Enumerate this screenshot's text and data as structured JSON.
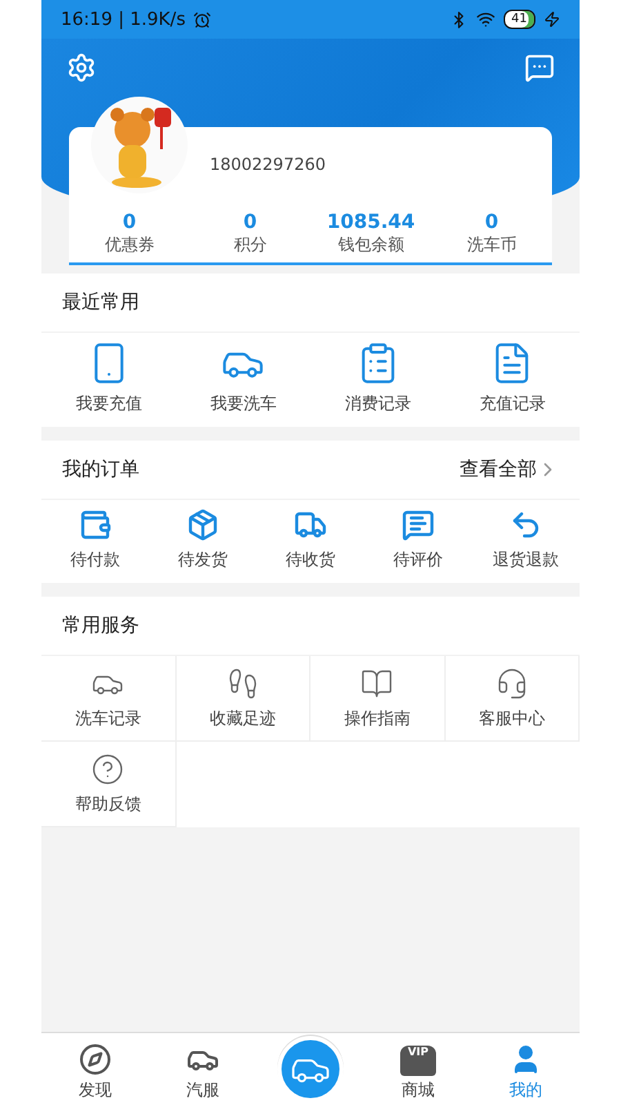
{
  "status_bar": {
    "time": "16:19 | 1.9K/s",
    "battery": "41"
  },
  "profile": {
    "phone": "18002297260",
    "stats": [
      {
        "value": "0",
        "label": "优惠券"
      },
      {
        "value": "0",
        "label": "积分"
      },
      {
        "value": "1085.44",
        "label": "钱包余额"
      },
      {
        "value": "0",
        "label": "洗车币"
      }
    ]
  },
  "recent": {
    "title": "最近常用",
    "items": [
      {
        "label": "我要充值",
        "kind": "phone"
      },
      {
        "label": "我要洗车",
        "kind": "carwash"
      },
      {
        "label": "消费记录",
        "kind": "clipboard"
      },
      {
        "label": "充值记录",
        "kind": "document"
      }
    ]
  },
  "orders": {
    "title": "我的订单",
    "view_all": "查看全部",
    "items": [
      {
        "label": "待付款",
        "kind": "wallet"
      },
      {
        "label": "待发货",
        "kind": "box"
      },
      {
        "label": "待收货",
        "kind": "truck"
      },
      {
        "label": "待评价",
        "kind": "comment"
      },
      {
        "label": "退货退款",
        "kind": "return"
      }
    ]
  },
  "services": {
    "title": "常用服务",
    "items": [
      {
        "label": "洗车记录",
        "kind": "wash"
      },
      {
        "label": "收藏足迹",
        "kind": "foot"
      },
      {
        "label": "操作指南",
        "kind": "book"
      },
      {
        "label": "客服中心",
        "kind": "headset"
      },
      {
        "label": "帮助反馈",
        "kind": "help"
      }
    ]
  },
  "nav": [
    {
      "kind": "compass",
      "label": "发现",
      "selected": false
    },
    {
      "kind": "car",
      "label": "汽服",
      "selected": false
    },
    {
      "kind": "center"
    },
    {
      "kind": "vip",
      "label": "商城",
      "badge": "VIP",
      "selected": false
    },
    {
      "kind": "user",
      "label": "我的",
      "selected": true
    }
  ]
}
